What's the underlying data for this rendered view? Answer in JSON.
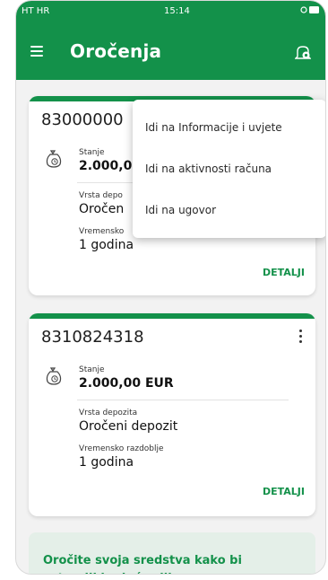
{
  "status_bar": {
    "carrier": "HT HR",
    "time": "15:14"
  },
  "app_bar": {
    "title": "Oročenja",
    "menu_icon": "hamburger-icon",
    "notification_icon": "bell-icon"
  },
  "accounts": [
    {
      "number": "83000000",
      "balance_label": "Stanje",
      "balance": "2.000,0",
      "deposit_type_label": "Vrsta depo",
      "deposit_type": "Oročen",
      "period_label": "Vremensko",
      "period": "1 godina",
      "details_label": "DETALJI"
    },
    {
      "number": "8310824318",
      "balance_label": "Stanje",
      "balance": "2.000,00 EUR",
      "deposit_type_label": "Vrsta depozita",
      "deposit_type": "Oročeni depozit",
      "period_label": "Vremensko razdoblje",
      "period": "1 godina",
      "details_label": "DETALJI"
    }
  ],
  "dropdown_menu": {
    "items": [
      "Idi na Informacije i uvjete",
      "Idi na aktivnosti računa",
      "Idi na ugovor"
    ]
  },
  "promo": {
    "text": "Oročite svoja sredstva kako bi ostvarili buduće ciljeve"
  },
  "colors": {
    "brand_green": "#13914a",
    "promo_bg": "#e4efe8"
  }
}
